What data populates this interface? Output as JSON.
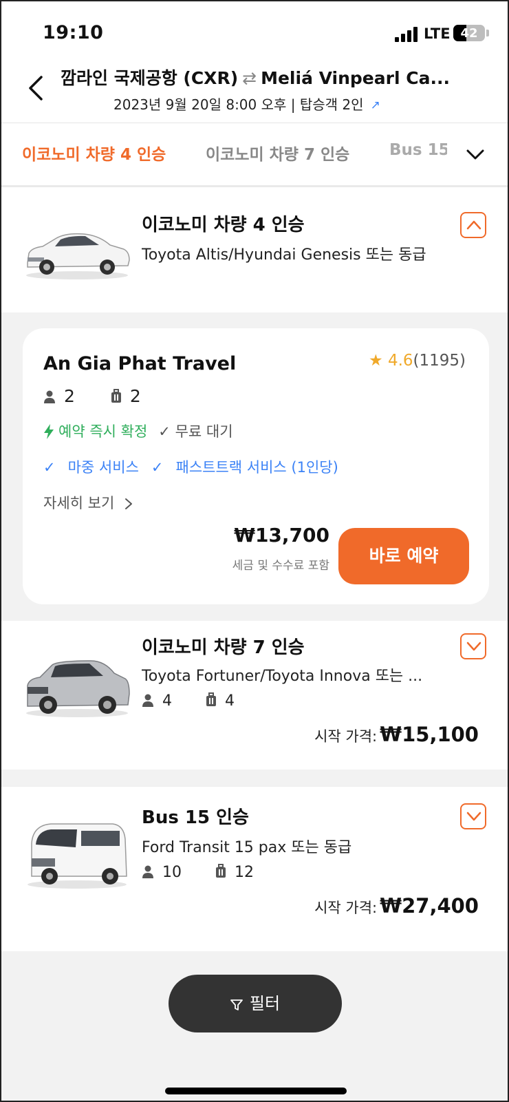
{
  "status_bar": {
    "time": "19:10",
    "network": "LTE",
    "battery": "42",
    "battery_level": 0.42
  },
  "header": {
    "origin": "깜라인 국제공항 (CXR)",
    "destination": "Meliá Vinpearl Ca...",
    "subtitle": "2023년 9월 20일 8:00 오후 | 탑승객 2인"
  },
  "tabs": [
    {
      "label": "이코노미 차량 4 인승",
      "active": true
    },
    {
      "label": "이코노미 차량 7 인승",
      "active": false
    },
    {
      "label": "Bus 15",
      "active": false
    }
  ],
  "vehicles": [
    {
      "title": "이코노미 차량 4 인승",
      "model": "Toyota Altis/Hyundai Genesis 또는 동급",
      "expanded": true
    },
    {
      "title": "이코노미 차량 7 인승",
      "model": "Toyota Fortuner/Toyota Innova 또는 ...",
      "passengers": "4",
      "luggage": "4",
      "from_label": "시작 가격:",
      "price": "₩15,100"
    },
    {
      "title": "Bus 15 인승",
      "model": "Ford Transit 15 pax 또는 동급",
      "passengers": "10",
      "luggage": "12",
      "from_label": "시작 가격:",
      "price": "₩27,400"
    }
  ],
  "offer": {
    "provider": "An Gia Phat Travel",
    "rating": "4.6",
    "reviews": "(1195)",
    "passengers": "2",
    "luggage": "2",
    "instant": "예약 즉시 확정",
    "free_wait": "무료 대기",
    "meet_greet": "마중 서비스",
    "fast_track": "패스트트랙 서비스 (1인당)",
    "details": "자세히 보기",
    "price": "₩13,700",
    "price_note": "세금 및 수수료 포함",
    "book_label": "바로 예약"
  },
  "filter": {
    "label": "필터"
  },
  "colors": {
    "accent": "#f06a2a",
    "green": "#2fae5b",
    "blue": "#3b82f6",
    "star": "#f0a92a"
  }
}
